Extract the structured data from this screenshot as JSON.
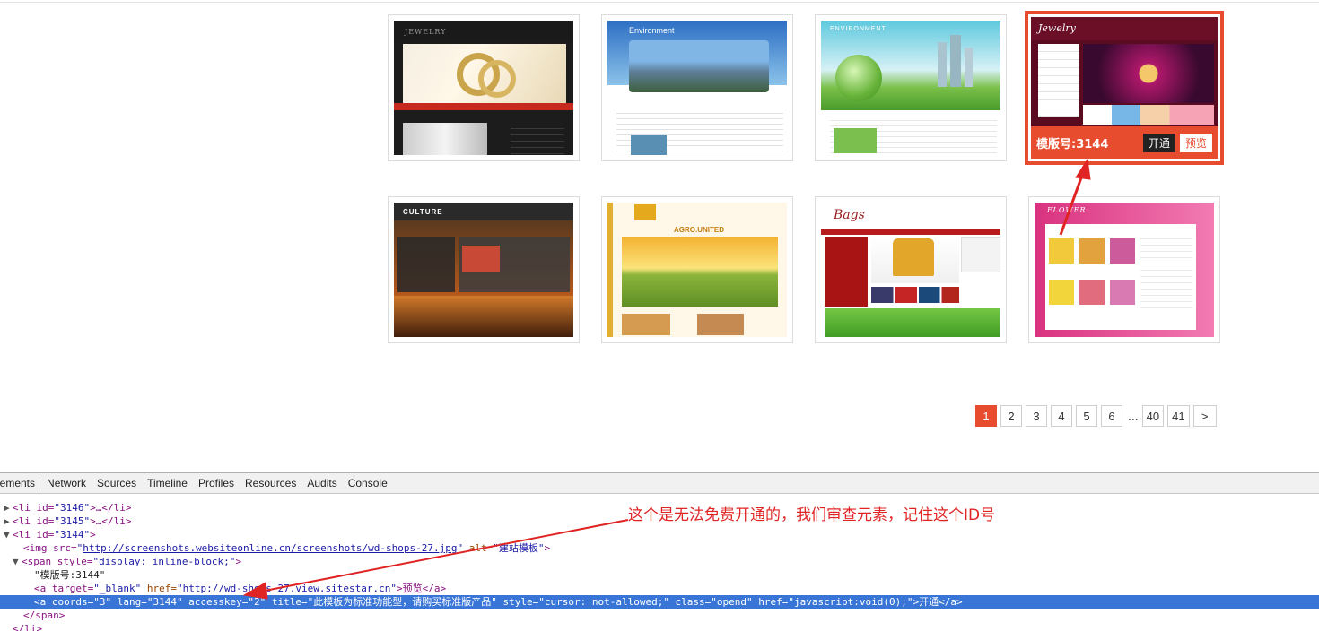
{
  "templates": [
    {
      "title": "JEWELRY"
    },
    {
      "title": "Environment"
    },
    {
      "title": "ENVIRONMENT"
    },
    {
      "title": "Jewelry",
      "code_label": "模版号:3144",
      "open_label": "开通",
      "preview_label": "预览"
    },
    {
      "title": "CULTURE"
    },
    {
      "title": "AGRO.UNITED"
    },
    {
      "title": "Bags"
    },
    {
      "title": "FLOWER"
    }
  ],
  "pagination": {
    "pages": [
      "1",
      "2",
      "3",
      "4",
      "5",
      "6"
    ],
    "ellipsis": "...",
    "tail": [
      "40",
      "41"
    ],
    "next": ">",
    "current": "1"
  },
  "devtools": {
    "tabs": [
      "lements",
      "Network",
      "Sources",
      "Timeline",
      "Profiles",
      "Resources",
      "Audits",
      "Console"
    ],
    "lines": {
      "l1_tag_open": "<li id=",
      "l1_id": "\"3146\"",
      "l1_rest": ">…</li>",
      "l2_tag_open": "<li id=",
      "l2_id": "\"3145\"",
      "l2_rest": ">…</li>",
      "l3_tag_open": "<li id=",
      "l3_id": "\"3144\"",
      "l3_rest": ">",
      "img_open": "<img src=",
      "img_src": "http://screenshots.websiteonline.cn/screenshots/wd-shops-27.jpg",
      "img_alt_attr": " alt=",
      "img_alt": "\"建站模板\"",
      "img_close": ">",
      "span_open": "<span style=",
      "span_style": "\"display: inline-block;\"",
      "span_close": ">",
      "text_code": "\"模版号:3144\"",
      "a1_open": "<a target=",
      "a1_target": "\"_blank\"",
      "a1_href_attr": " href=",
      "a1_href": "\"http://wd-shops-27.view.sitestar.cn\"",
      "a1_text": ">预览</a>",
      "a2_full": "<a coords=\"3\" lang=\"3144\" accesskey=\"2\" title=\"此模板为标准功能型，请购买标准版产品\" style=\"cursor: not-allowed;\" class=\"opend\" href=\"javascript:void(0);\">开通</a>",
      "span_end": "</span>",
      "li_end": "</li>"
    }
  },
  "annotation": "这个是无法免费开通的，我们审查元素，记住这个ID号",
  "colors": {
    "accent": "#e84c2e",
    "highlight": "#3875d7",
    "annotation": "#e02424"
  }
}
